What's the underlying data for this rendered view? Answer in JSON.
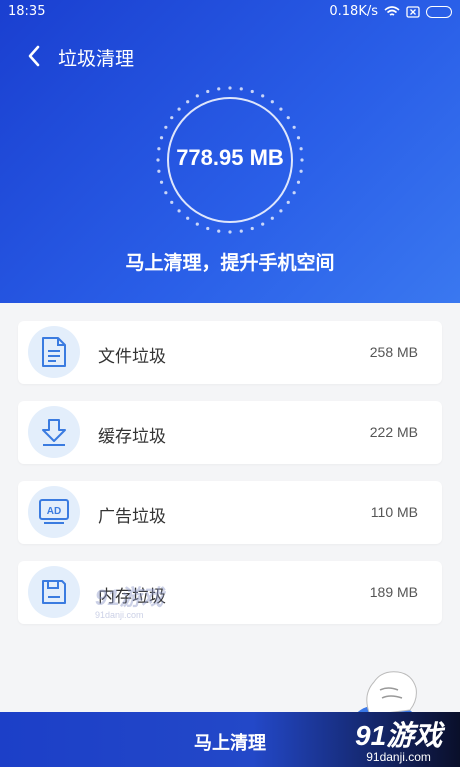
{
  "status_bar": {
    "time": "18:35",
    "net_speed": "0.18K/s"
  },
  "nav": {
    "title": "垃圾清理"
  },
  "summary": {
    "total_size": "778.95 MB",
    "slogan": "马上清理，提升手机空间"
  },
  "items": [
    {
      "label": "文件垃圾",
      "size": "258 MB",
      "icon": "document-icon"
    },
    {
      "label": "缓存垃圾",
      "size": "222 MB",
      "icon": "download-icon"
    },
    {
      "label": "广告垃圾",
      "size": "110 MB",
      "icon": "ad-icon"
    },
    {
      "label": "内存垃圾",
      "size": "189 MB",
      "icon": "memory-icon"
    }
  ],
  "action": {
    "clean_label": "马上清理"
  },
  "watermark": {
    "brand": "91游戏",
    "site": "91danji.com"
  },
  "colors": {
    "header_start": "#1a3fd0",
    "header_end": "#3a78f0",
    "icon_bg": "#e3eefb",
    "icon_stroke": "#3a7be0"
  }
}
